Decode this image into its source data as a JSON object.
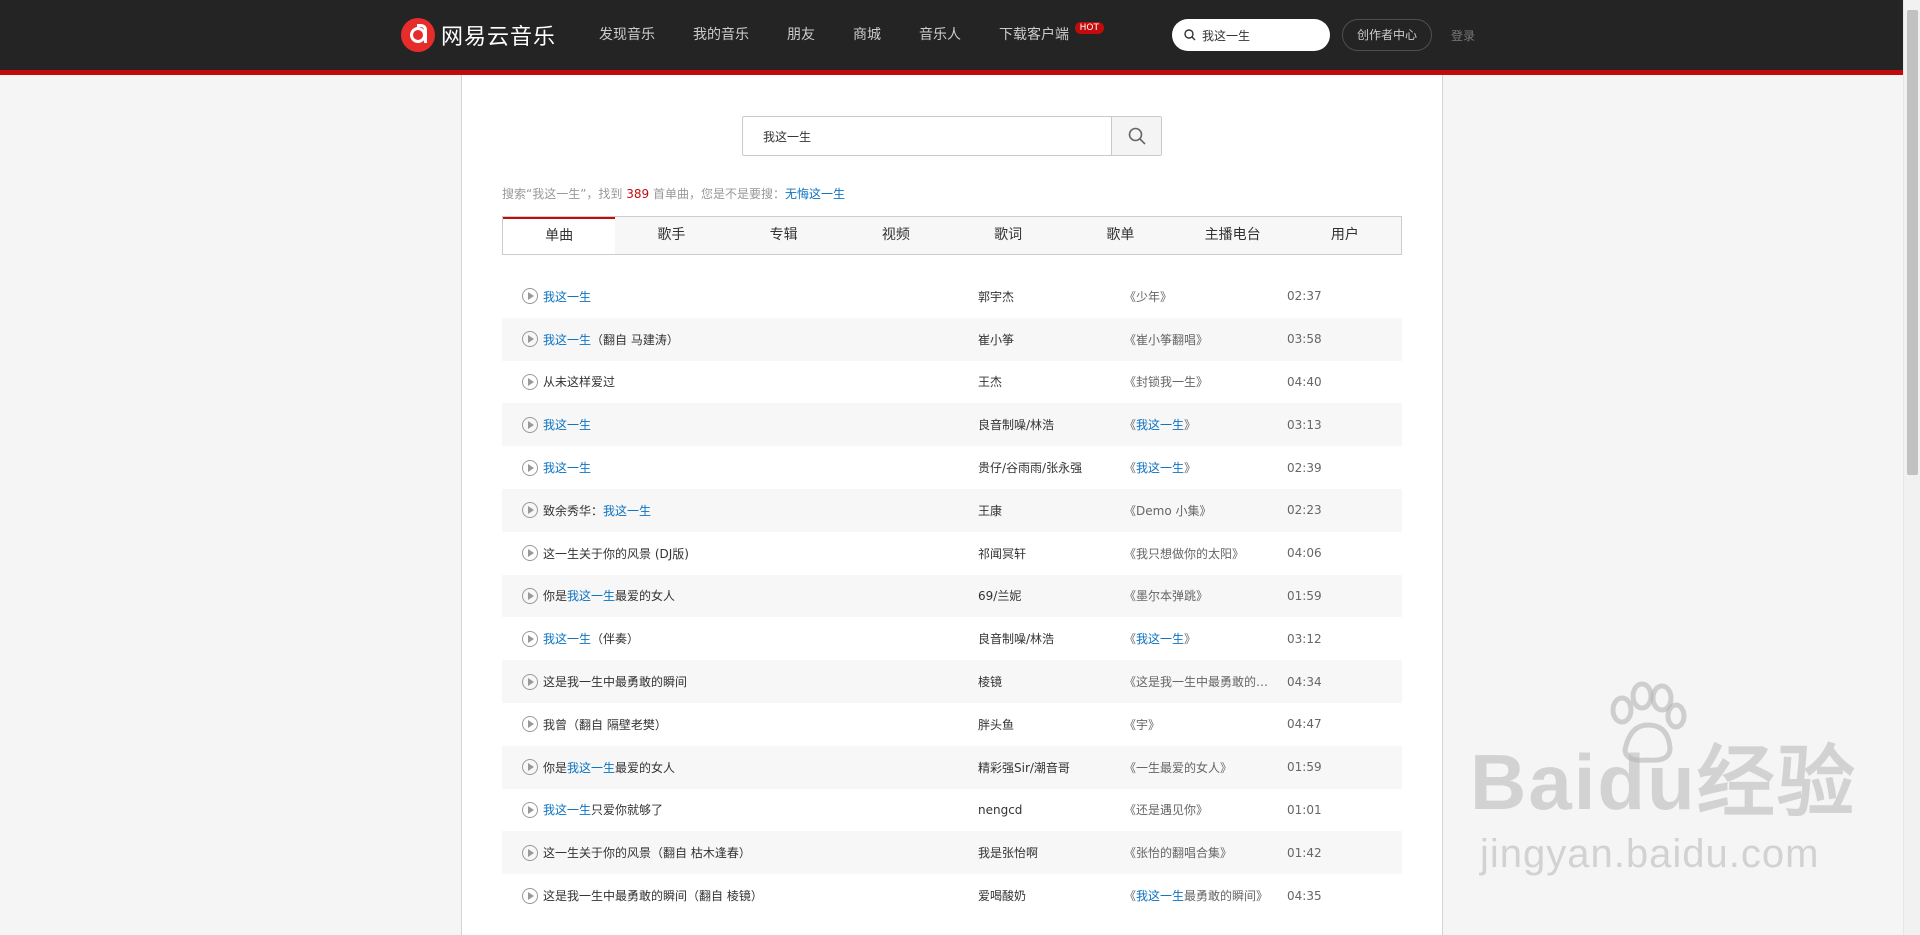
{
  "header": {
    "logo_text": "网易云音乐",
    "nav": [
      "发现音乐",
      "我的音乐",
      "朋友",
      "商城",
      "音乐人",
      "下载客户端"
    ],
    "hot_badge": "HOT",
    "search_value": "我这一生",
    "creator_label": "创作者中心",
    "login_label": "登录"
  },
  "search": {
    "value": "我这一生",
    "summary_prefix": "搜索“我这一生”，找到",
    "summary_count": "389",
    "summary_mid": "首单曲，您是不是要搜：",
    "suggestion": "无悔这一生"
  },
  "tabs": [
    "单曲",
    "歌手",
    "专辑",
    "视频",
    "歌词",
    "歌单",
    "主播电台",
    "用户"
  ],
  "songs": [
    {
      "title": [
        [
          "我这一生",
          true
        ]
      ],
      "artist": "郭宇杰",
      "album": [
        [
          "《少年》",
          false
        ]
      ],
      "duration": "02:37"
    },
    {
      "title": [
        [
          "我这一生",
          true
        ],
        [
          "（翻自 马建涛）",
          false
        ]
      ],
      "artist": "崔小筝",
      "album": [
        [
          "《崔小筝翻唱》",
          false
        ]
      ],
      "duration": "03:58"
    },
    {
      "title": [
        [
          "从未这样爱过",
          false
        ]
      ],
      "artist": "王杰",
      "album": [
        [
          "《封锁我一生》",
          false
        ]
      ],
      "duration": "04:40"
    },
    {
      "title": [
        [
          "我这一生",
          true
        ]
      ],
      "artist": "良音制噪/林浩",
      "album": [
        [
          "《",
          false
        ],
        [
          "我这一生",
          true
        ],
        [
          "》",
          false
        ]
      ],
      "duration": "03:13"
    },
    {
      "title": [
        [
          "我这一生",
          true
        ]
      ],
      "artist": "贵仔/谷雨雨/张永强",
      "album": [
        [
          "《",
          false
        ],
        [
          "我这一生",
          true
        ],
        [
          "》",
          false
        ]
      ],
      "duration": "02:39"
    },
    {
      "title": [
        [
          "致余秀华：",
          false
        ],
        [
          "我这一生",
          true
        ]
      ],
      "artist": "王康",
      "album": [
        [
          "《Demo 小集》",
          false
        ]
      ],
      "duration": "02:23"
    },
    {
      "title": [
        [
          "这一生关于你的风景 (DJ版)",
          false
        ]
      ],
      "artist": "祁闻冥轩",
      "album": [
        [
          "《我只想做你的太阳》",
          false
        ]
      ],
      "duration": "04:06"
    },
    {
      "title": [
        [
          "你是",
          false
        ],
        [
          "我这一生",
          true
        ],
        [
          "最爱的女人",
          false
        ]
      ],
      "artist": "69/兰妮",
      "album": [
        [
          "《墨尔本弹跳》",
          false
        ]
      ],
      "duration": "01:59"
    },
    {
      "title": [
        [
          "我这一生",
          true
        ],
        [
          "（伴奏）",
          false
        ]
      ],
      "artist": "良音制噪/林浩",
      "album": [
        [
          "《",
          false
        ],
        [
          "我这一生",
          true
        ],
        [
          "》",
          false
        ]
      ],
      "duration": "03:12"
    },
    {
      "title": [
        [
          "这是我一生中最勇敢的瞬间",
          false
        ]
      ],
      "artist": "棱镜",
      "album": [
        [
          "《这是我一生中最勇敢的瞬间》",
          false
        ]
      ],
      "duration": "04:34"
    },
    {
      "title": [
        [
          "我曾（翻自 隔壁老樊）",
          false
        ]
      ],
      "artist": "胖头鱼",
      "album": [
        [
          "《宇》",
          false
        ]
      ],
      "duration": "04:47"
    },
    {
      "title": [
        [
          "你是",
          false
        ],
        [
          "我这一生",
          true
        ],
        [
          "最爱的女人",
          false
        ]
      ],
      "artist": "精彩强Sir/潮音哥",
      "album": [
        [
          "《一生最爱的女人》",
          false
        ]
      ],
      "duration": "01:59"
    },
    {
      "title": [
        [
          "我这一生",
          true
        ],
        [
          "只爱你就够了",
          false
        ]
      ],
      "artist": "nengcd",
      "album": [
        [
          "《还是遇见你》",
          false
        ]
      ],
      "duration": "01:01"
    },
    {
      "title": [
        [
          "这一生关于你的风景（翻自 枯木逢春）",
          false
        ]
      ],
      "artist": "我是张怡啊",
      "album": [
        [
          "《张怡的翻唱合集》",
          false
        ]
      ],
      "duration": "01:42"
    },
    {
      "title": [
        [
          "这是我一生中最勇敢的瞬间（翻自 棱镜）",
          false
        ]
      ],
      "artist": "爱喝酸奶",
      "album": [
        [
          "《",
          false
        ],
        [
          "我这一生",
          true
        ],
        [
          "最勇敢的瞬间》",
          false
        ]
      ],
      "duration": "04:35"
    }
  ],
  "watermark": {
    "big": "Bai",
    "big2": "du",
    "cn": "经验",
    "url": "jingyan.baidu.com"
  }
}
